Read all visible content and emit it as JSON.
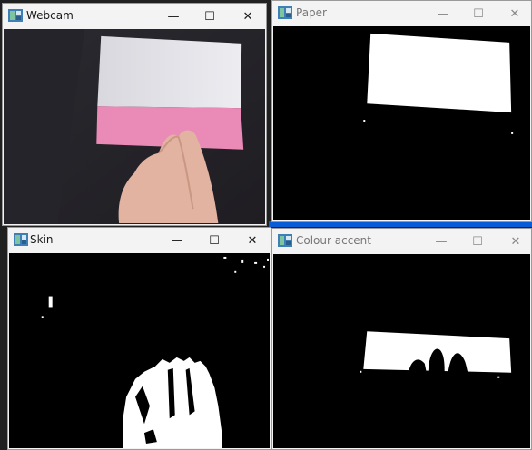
{
  "windows": {
    "webcam": {
      "title": "Webcam"
    },
    "paper": {
      "title": "Paper"
    },
    "skin": {
      "title": "Skin"
    },
    "colour_accent": {
      "title": "Colour accent"
    }
  },
  "controls": {
    "minimize_glyph": "—",
    "maximize_glyph": "☐",
    "close_glyph": "✕"
  },
  "colors": {
    "titlebar": "#f3f3f3",
    "mask_foreground": "#ffffff",
    "mask_background": "#000000",
    "paper_white": "#e9e9ee",
    "paper_pink": "#ee86b7",
    "skin_tone": "#e8b9a4"
  },
  "icons": [
    "opencv-window-icon",
    "minimize-icon",
    "maximize-icon",
    "close-icon"
  ]
}
